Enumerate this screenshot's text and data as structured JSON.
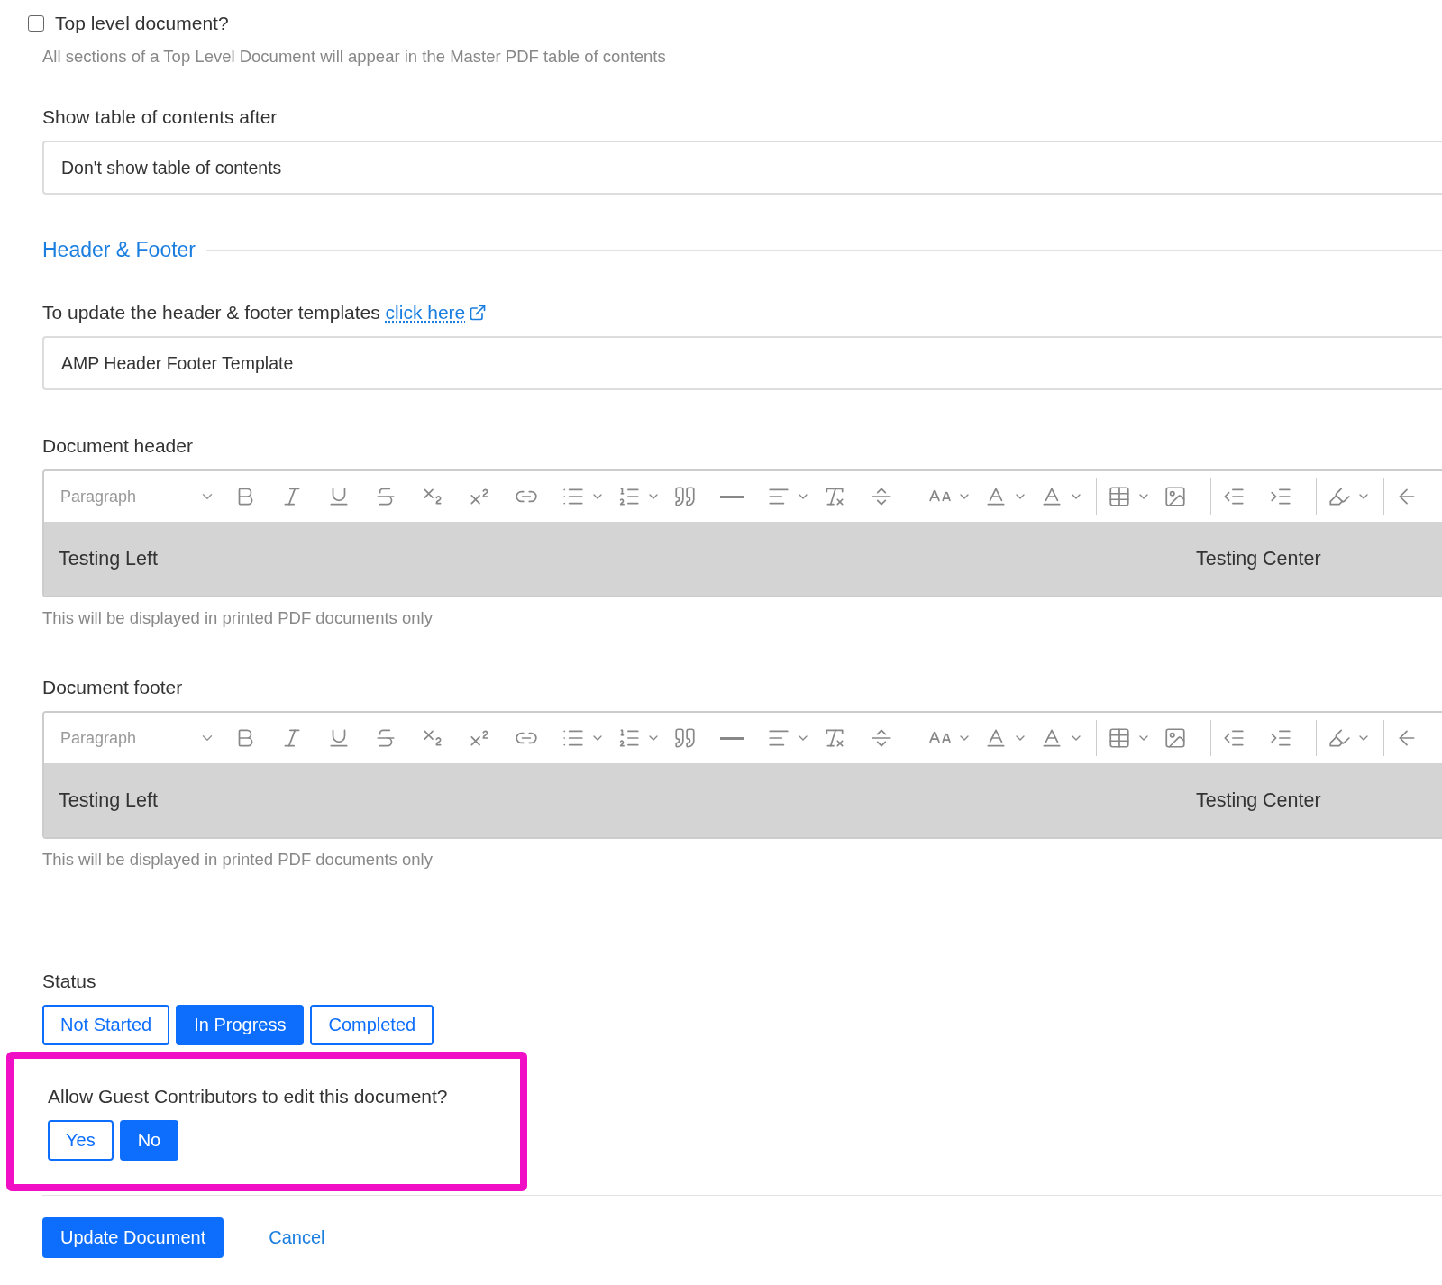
{
  "top_level": {
    "label": "Top level document?",
    "checked": false,
    "hint": "All sections of a Top Level Document will appear in the Master PDF table of contents"
  },
  "toc": {
    "label": "Show table of contents after",
    "value": "Don't show table of contents"
  },
  "section_heading": "Header & Footer",
  "template": {
    "label": "To update the header & footer templates",
    "link": "click here",
    "value": "AMP Header Footer Template"
  },
  "editors": [
    {
      "label": "Document header",
      "format": "Paragraph",
      "left": "Testing Left",
      "center": "Testing Center",
      "hint": "This will be displayed in printed PDF documents only"
    },
    {
      "label": "Document footer",
      "format": "Paragraph",
      "left": "Testing Left",
      "center": "Testing Center",
      "hint": "This will be displayed in printed PDF documents only"
    }
  ],
  "status": {
    "label": "Status",
    "options": [
      {
        "label": "Not Started",
        "selected": false
      },
      {
        "label": "In Progress",
        "selected": true
      },
      {
        "label": "Completed",
        "selected": false
      }
    ]
  },
  "guest": {
    "label": "Allow Guest Contributors to edit this document?",
    "highlighted": true,
    "options": [
      {
        "label": "Yes",
        "selected": false
      },
      {
        "label": "No",
        "selected": true
      }
    ]
  },
  "actions": {
    "primary": "Update Document",
    "secondary": "Cancel"
  }
}
